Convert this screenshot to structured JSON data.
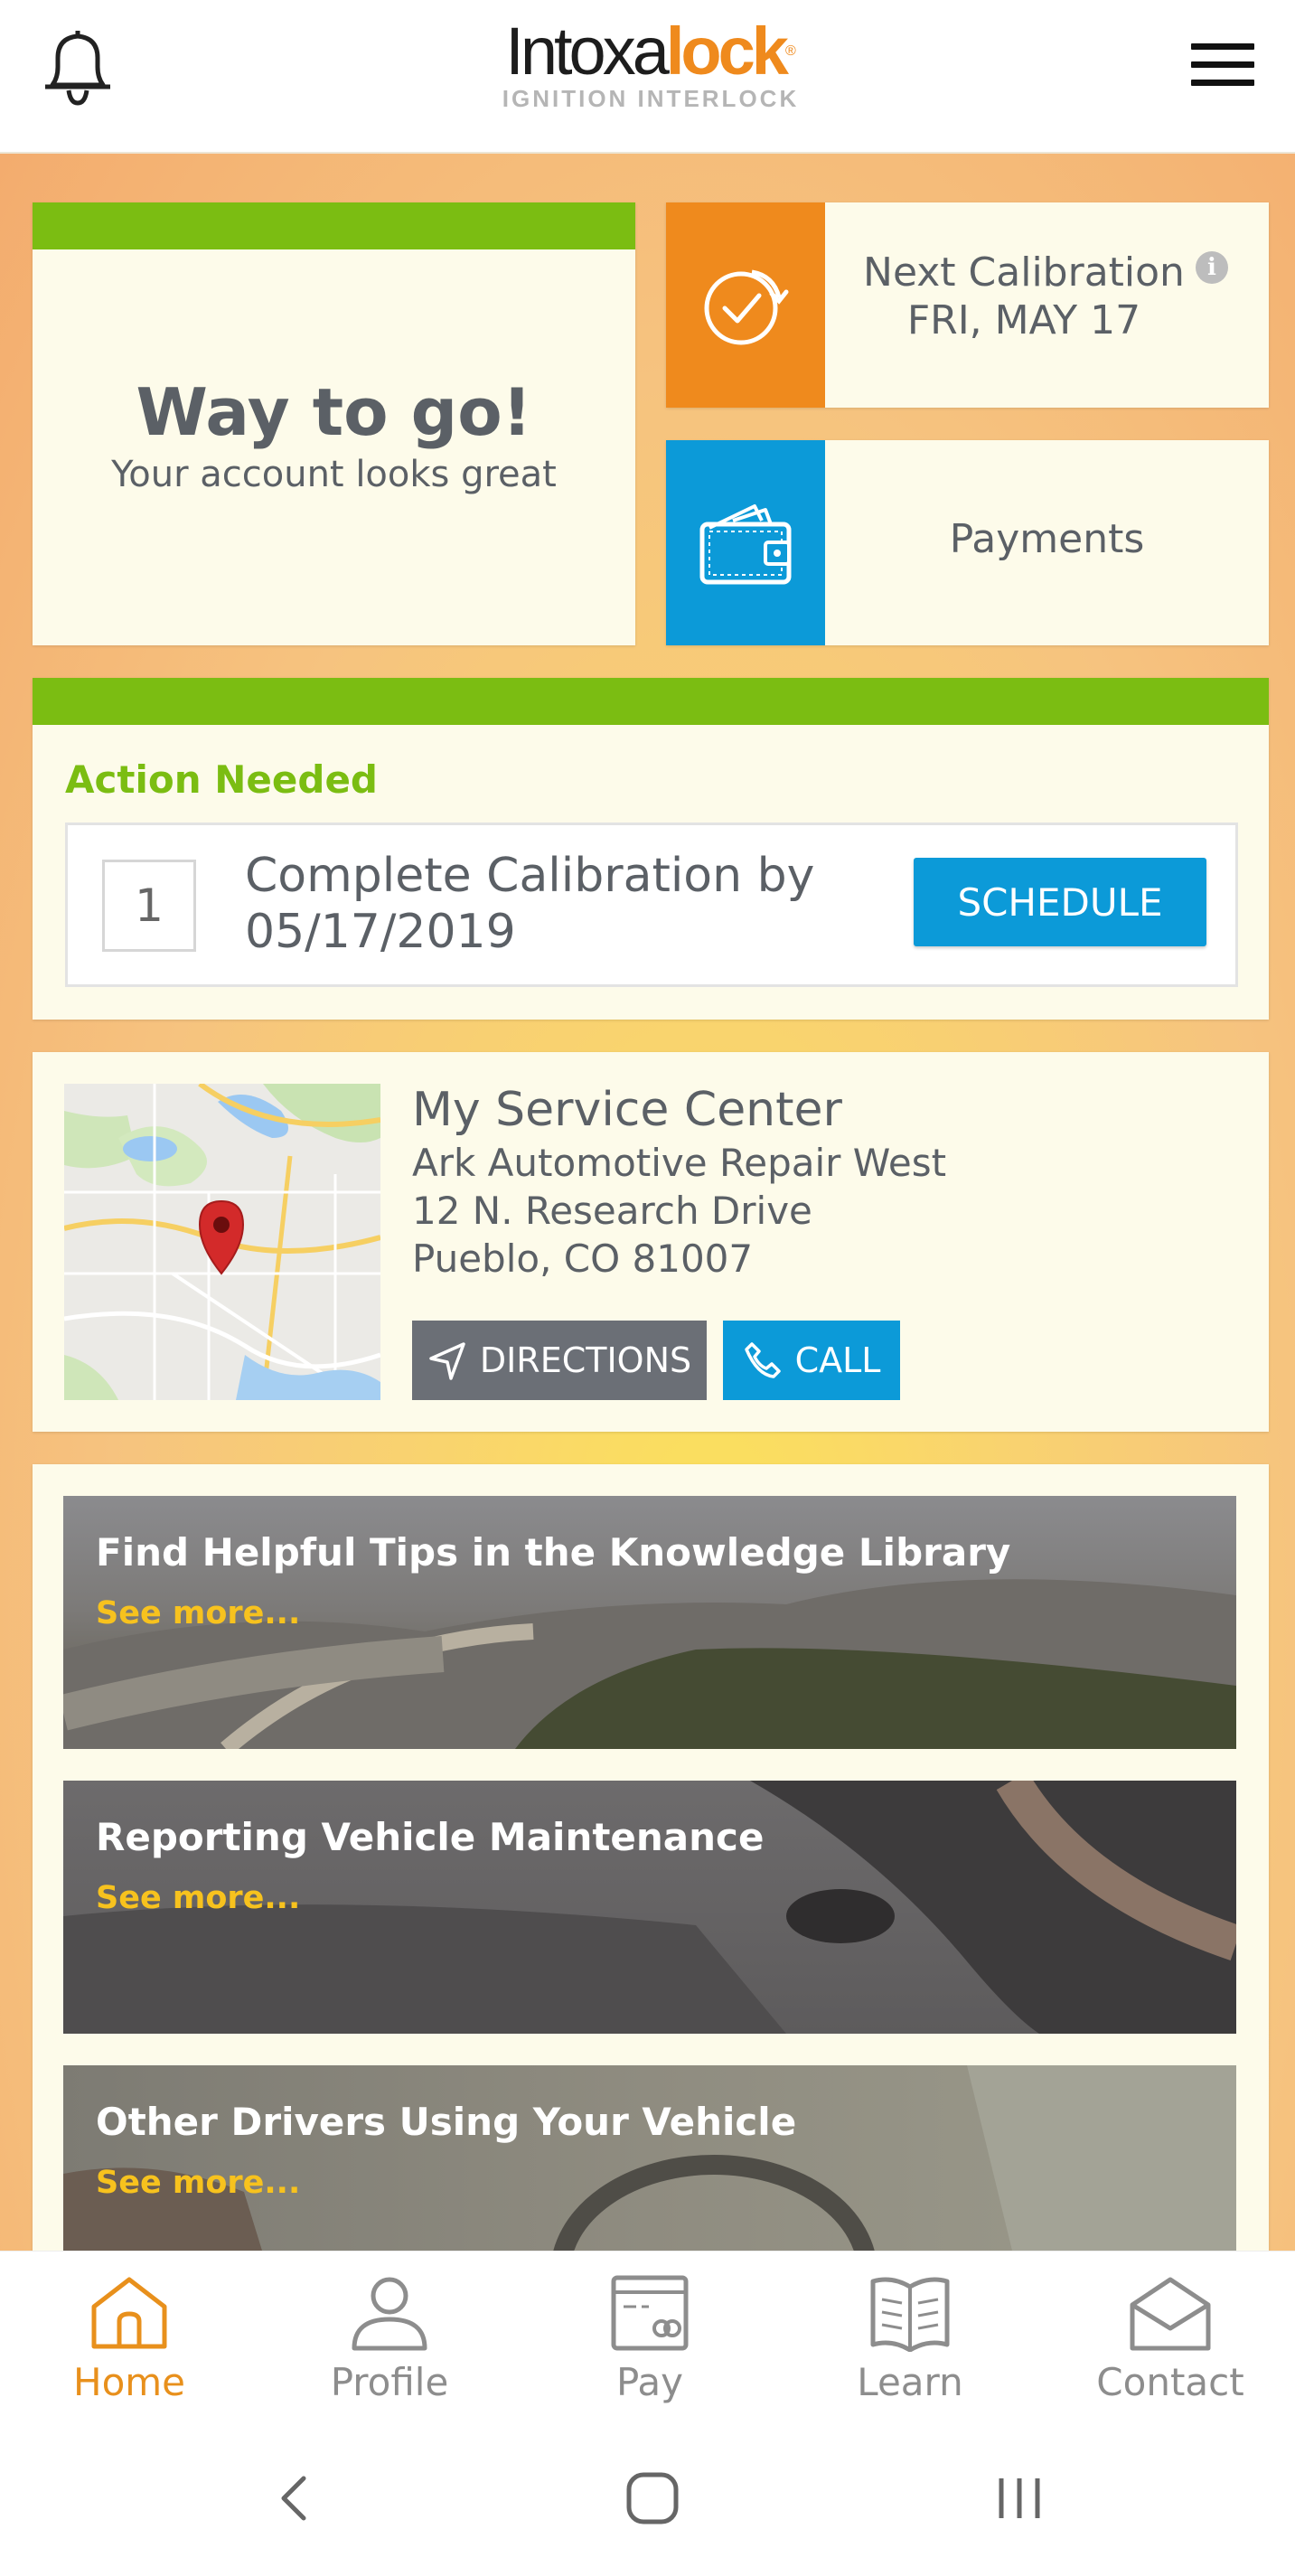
{
  "header": {
    "logo_main_a": "Intoxa",
    "logo_main_b": "lock",
    "logo_reg": "®",
    "logo_sub": "IGNITION INTERLOCK",
    "bell_icon": "bell-icon",
    "menu_icon": "hamburger-menu-icon"
  },
  "status_card": {
    "headline": "Way to go!",
    "subtext": "Your account looks great"
  },
  "calibration_tile": {
    "title": "Next Calibration",
    "date": "FRI, MAY 17",
    "icon": "clock-check-icon",
    "info_icon": "info-icon"
  },
  "payments_tile": {
    "label": "Payments",
    "icon": "wallet-icon"
  },
  "action_card": {
    "heading": "Action Needed",
    "count": "1",
    "task_line1": "Complete Calibration by",
    "task_line2": "05/17/2019",
    "schedule_label": "SCHEDULE"
  },
  "service_center": {
    "heading": "My Service Center",
    "name": "Ark Automotive Repair West",
    "address1": "12 N. Research Drive",
    "address2": "Pueblo, CO 81007",
    "directions_label": "DIRECTIONS",
    "call_label": "CALL"
  },
  "promos": [
    {
      "title": "Find Helpful Tips in the Knowledge Library",
      "more": "See more..."
    },
    {
      "title": "Reporting Vehicle Maintenance",
      "more": "See more..."
    },
    {
      "title": "Other Drivers Using Your Vehicle",
      "more": "See more..."
    }
  ],
  "bottom_nav": [
    {
      "label": "Home",
      "icon": "home-icon",
      "active": true
    },
    {
      "label": "Profile",
      "icon": "profile-icon",
      "active": false
    },
    {
      "label": "Pay",
      "icon": "pay-icon",
      "active": false
    },
    {
      "label": "Learn",
      "icon": "book-icon",
      "active": false
    },
    {
      "label": "Contact",
      "icon": "envelope-icon",
      "active": false
    }
  ],
  "colors": {
    "accent_green": "#7bbd12",
    "accent_orange": "#ef8a1d",
    "accent_blue": "#0c9ad8",
    "button_gray": "#6b6f76",
    "link_yellow": "#f7c21e"
  }
}
